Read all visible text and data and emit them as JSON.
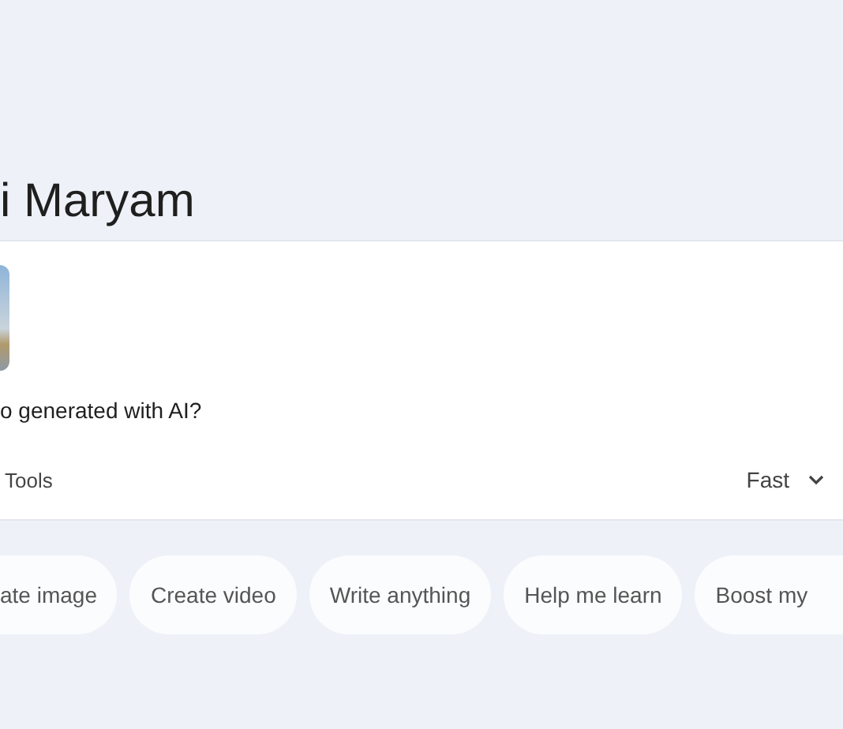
{
  "greeting": "i Maryam",
  "prompt_box": {
    "prompt_text": "o generated with AI?",
    "tools_label": "Tools",
    "model_picker": "Fast"
  },
  "suggestion_chips": [
    "ate image",
    "Create video",
    "Write anything",
    "Help me learn",
    "Boost my"
  ]
}
